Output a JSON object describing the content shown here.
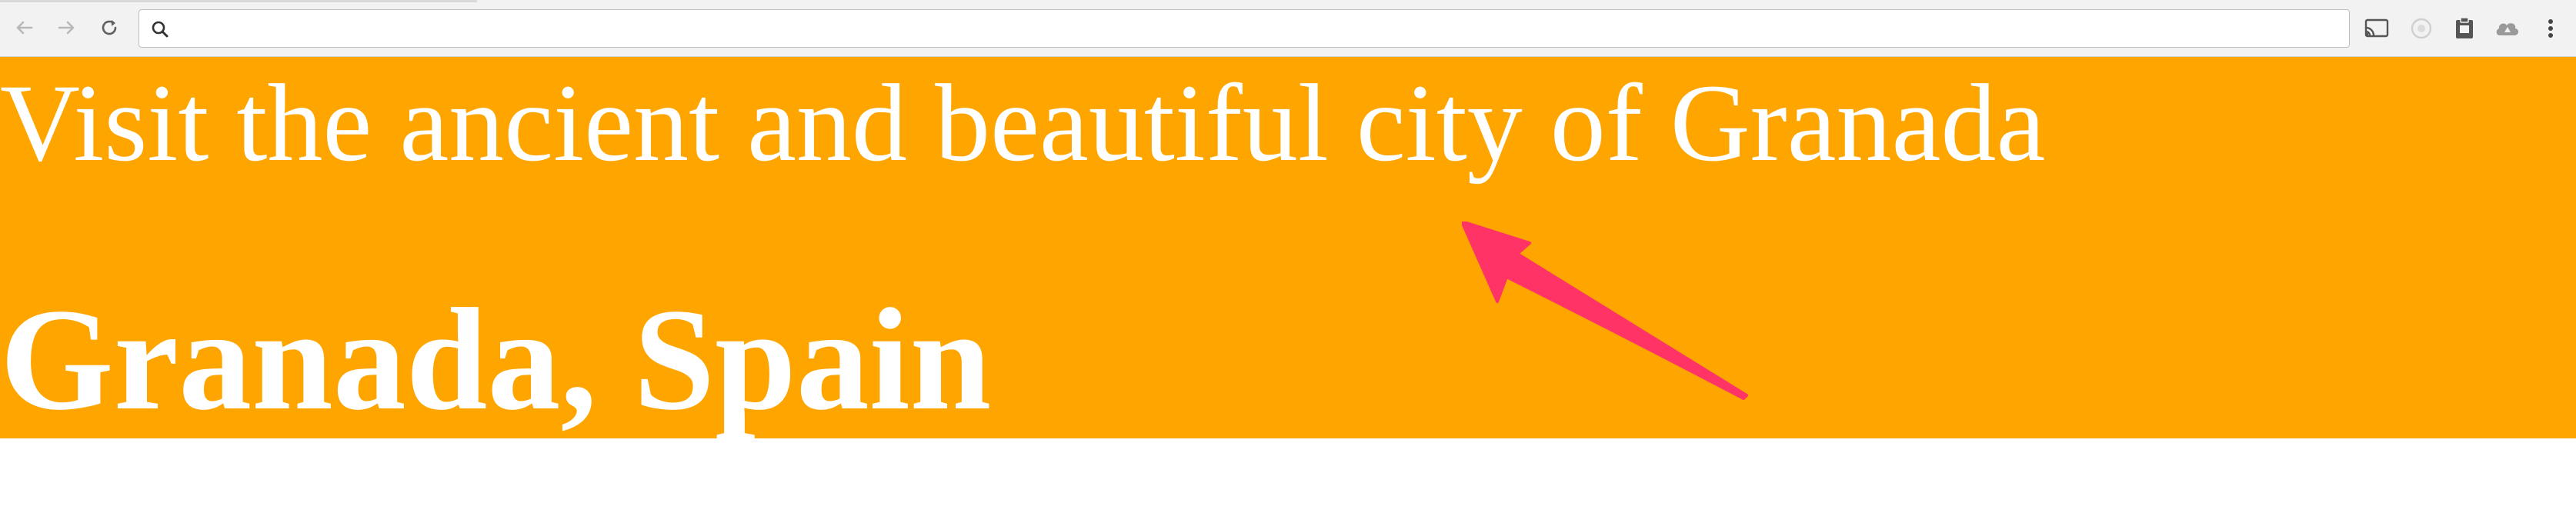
{
  "browser": {
    "url_text": "",
    "icons": {
      "back": "back-arrow-icon",
      "forward": "forward-arrow-icon",
      "reload": "reload-icon",
      "search": "search-icon",
      "cast": "cast-icon",
      "extensions": [
        "extension-circle-icon",
        "extension-clipboard-icon",
        "drive-icon",
        "menu-kebab-icon"
      ]
    }
  },
  "hero": {
    "tagline": "Visit the ancient and beautiful city of Granada",
    "title": "Granada, Spain",
    "background_color": "#ffa500",
    "text_color": "#ffffff"
  },
  "annotation": {
    "arrow_color": "#ff3366"
  }
}
